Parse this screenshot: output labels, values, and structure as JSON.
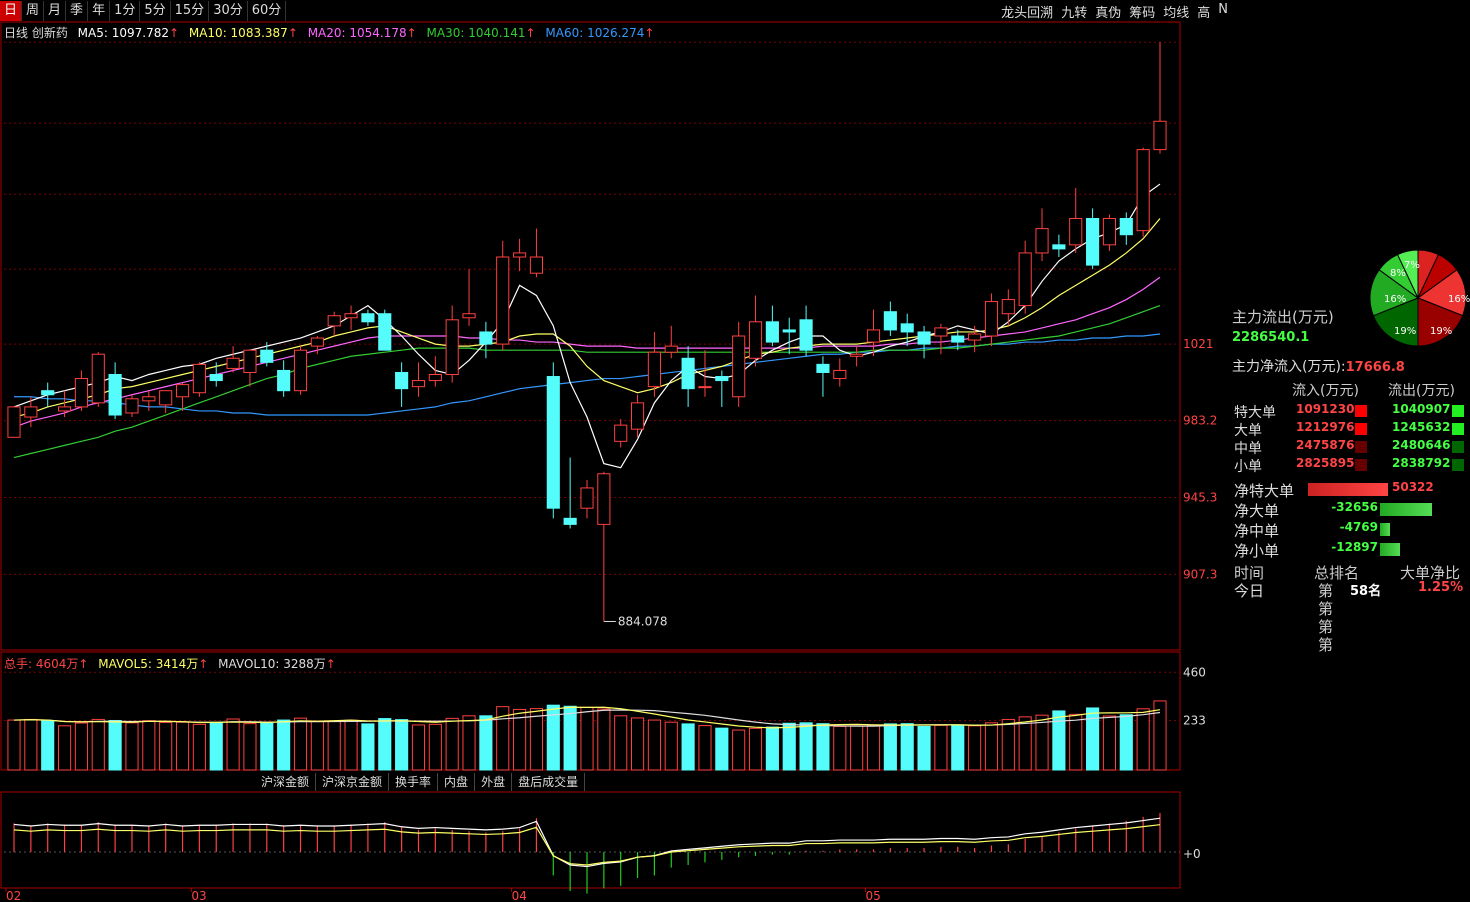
{
  "toolbar": {
    "periods": [
      "日",
      "周",
      "月",
      "季",
      "年",
      "1分",
      "5分",
      "15分",
      "30分",
      "60分"
    ],
    "active_period": "日",
    "right_items": [
      "龙头回溯",
      "九转",
      "真伪",
      "筹码",
      "均线",
      "高",
      "N"
    ]
  },
  "legend": {
    "name": "日线 创新药",
    "ma5": "MA5: 1097.782",
    "ma10": "MA10: 1083.387",
    "ma20": "MA20: 1054.178",
    "ma30": "MA30: 1040.141",
    "ma60": "MA60: 1026.274",
    "arrow": "↑"
  },
  "volume_legend": {
    "total": "总手: 4604万",
    "mavol5": "MAVOL5: 3414万",
    "mavol10": "MAVOL10: 3288万",
    "arrow": "↑"
  },
  "bottom_tabs": [
    "沪深金额",
    "沪深京金额",
    "换手率",
    "内盘",
    "外盘",
    "盘后成交量"
  ],
  "colors": {
    "up": "#ff4040",
    "down": "#54fcfc",
    "ma5": "#ffffff",
    "ma10": "#ffff66",
    "ma20": "#ff66ff",
    "ma30": "#33cc33",
    "ma60": "#3399ff",
    "grid": "#7a0000"
  },
  "chart_data": {
    "type": "candlestick",
    "price_axis_ticks": [
      1021,
      983.2,
      945.3,
      907.3
    ],
    "price_axis_labels": [
      "1021",
      "983.2",
      "945.3",
      "907.3"
    ],
    "price_range": [
      870,
      1180
    ],
    "low_marker": {
      "value": 884.078,
      "label": "884.078"
    },
    "volume_axis_labels": [
      "460",
      "233"
    ],
    "volume_range": [
      0,
      480
    ],
    "indicator_axis_label": "+0",
    "month_labels": [
      {
        "index": 0,
        "label": "02"
      },
      {
        "index": 11,
        "label": "03"
      },
      {
        "index": 30,
        "label": "04"
      },
      {
        "index": 51,
        "label": "05"
      }
    ],
    "candles": [
      {
        "o": 975,
        "h": 990,
        "l": 975,
        "c": 990
      },
      {
        "o": 985,
        "h": 995,
        "l": 980,
        "c": 990
      },
      {
        "o": 998,
        "h": 1002,
        "l": 990,
        "c": 996
      },
      {
        "o": 988,
        "h": 998,
        "l": 985,
        "c": 990
      },
      {
        "o": 990,
        "h": 1008,
        "l": 988,
        "c": 1004
      },
      {
        "o": 992,
        "h": 1017,
        "l": 990,
        "c": 1016
      },
      {
        "o": 1006,
        "h": 1012,
        "l": 984,
        "c": 986
      },
      {
        "o": 987,
        "h": 996,
        "l": 985,
        "c": 994
      },
      {
        "o": 993,
        "h": 998,
        "l": 988,
        "c": 995
      },
      {
        "o": 991,
        "h": 997,
        "l": 987,
        "c": 998
      },
      {
        "o": 995,
        "h": 1002,
        "l": 988,
        "c": 1001
      },
      {
        "o": 997,
        "h": 1012,
        "l": 995,
        "c": 1011
      },
      {
        "o": 1006,
        "h": 1012,
        "l": 1000,
        "c": 1003
      },
      {
        "o": 1009,
        "h": 1020,
        "l": 1007,
        "c": 1014
      },
      {
        "o": 1007,
        "h": 1018,
        "l": 1000,
        "c": 1018
      },
      {
        "o": 1018,
        "h": 1022,
        "l": 1010,
        "c": 1012
      },
      {
        "o": 1008,
        "h": 1013,
        "l": 995,
        "c": 998
      },
      {
        "o": 998,
        "h": 1020,
        "l": 996,
        "c": 1018
      },
      {
        "o": 1020,
        "h": 1025,
        "l": 1016,
        "c": 1024
      },
      {
        "o": 1030,
        "h": 1037,
        "l": 1025,
        "c": 1035
      },
      {
        "o": 1034,
        "h": 1040,
        "l": 1028,
        "c": 1036
      },
      {
        "o": 1036,
        "h": 1038,
        "l": 1030,
        "c": 1032
      },
      {
        "o": 1036,
        "h": 1038,
        "l": 1018,
        "c": 1018
      },
      {
        "o": 1007,
        "h": 1012,
        "l": 990,
        "c": 999
      },
      {
        "o": 1000,
        "h": 1012,
        "l": 995,
        "c": 1003
      },
      {
        "o": 1003,
        "h": 1015,
        "l": 1000,
        "c": 1006
      },
      {
        "o": 1006,
        "h": 1040,
        "l": 1002,
        "c": 1033
      },
      {
        "o": 1034,
        "h": 1058,
        "l": 1030,
        "c": 1036
      },
      {
        "o": 1027,
        "h": 1032,
        "l": 1014,
        "c": 1021
      },
      {
        "o": 1021,
        "h": 1072,
        "l": 1018,
        "c": 1064
      },
      {
        "o": 1064,
        "h": 1073,
        "l": 1057,
        "c": 1066
      },
      {
        "o": 1056,
        "h": 1078,
        "l": 1054,
        "c": 1064
      },
      {
        "o": 1005,
        "h": 1012,
        "l": 935,
        "c": 940
      },
      {
        "o": 935,
        "h": 965,
        "l": 930,
        "c": 932
      },
      {
        "o": 940,
        "h": 954,
        "l": 935,
        "c": 950
      },
      {
        "o": 932,
        "h": 958,
        "l": 884.078,
        "c": 957
      },
      {
        "o": 973,
        "h": 984,
        "l": 970,
        "c": 981
      },
      {
        "o": 979,
        "h": 996,
        "l": 975,
        "c": 992
      },
      {
        "o": 1000,
        "h": 1027,
        "l": 995,
        "c": 1017
      },
      {
        "o": 1017,
        "h": 1030,
        "l": 1014,
        "c": 1020
      },
      {
        "o": 1014,
        "h": 1020,
        "l": 990,
        "c": 999
      },
      {
        "o": 1000,
        "h": 1018,
        "l": 995,
        "c": 1000
      },
      {
        "o": 1005,
        "h": 1008,
        "l": 990,
        "c": 1003
      },
      {
        "o": 995,
        "h": 1032,
        "l": 990,
        "c": 1025
      },
      {
        "o": 1014,
        "h": 1045,
        "l": 1010,
        "c": 1032
      },
      {
        "o": 1032,
        "h": 1040,
        "l": 1020,
        "c": 1022
      },
      {
        "o": 1028,
        "h": 1034,
        "l": 1016,
        "c": 1027
      },
      {
        "o": 1033,
        "h": 1040,
        "l": 1015,
        "c": 1018
      },
      {
        "o": 1011,
        "h": 1015,
        "l": 995,
        "c": 1007
      },
      {
        "o": 1004,
        "h": 1014,
        "l": 1000,
        "c": 1008
      },
      {
        "o": 1015,
        "h": 1020,
        "l": 1010,
        "c": 1016
      },
      {
        "o": 1022,
        "h": 1038,
        "l": 1015,
        "c": 1028
      },
      {
        "o": 1037,
        "h": 1042,
        "l": 1025,
        "c": 1028
      },
      {
        "o": 1031,
        "h": 1036,
        "l": 1020,
        "c": 1027
      },
      {
        "o": 1027,
        "h": 1030,
        "l": 1014,
        "c": 1021
      },
      {
        "o": 1025,
        "h": 1031,
        "l": 1016,
        "c": 1029
      },
      {
        "o": 1025,
        "h": 1028,
        "l": 1018,
        "c": 1022
      },
      {
        "o": 1023,
        "h": 1030,
        "l": 1017,
        "c": 1026
      },
      {
        "o": 1025,
        "h": 1046,
        "l": 1020,
        "c": 1042
      },
      {
        "o": 1036,
        "h": 1048,
        "l": 1030,
        "c": 1043
      },
      {
        "o": 1040,
        "h": 1072,
        "l": 1036,
        "c": 1066
      },
      {
        "o": 1066,
        "h": 1088,
        "l": 1062,
        "c": 1078
      },
      {
        "o": 1070,
        "h": 1075,
        "l": 1064,
        "c": 1068
      },
      {
        "o": 1070,
        "h": 1098,
        "l": 1066,
        "c": 1083
      },
      {
        "o": 1083,
        "h": 1088,
        "l": 1058,
        "c": 1060
      },
      {
        "o": 1070,
        "h": 1085,
        "l": 1067,
        "c": 1083
      },
      {
        "o": 1083,
        "h": 1086,
        "l": 1070,
        "c": 1075
      },
      {
        "o": 1077,
        "h": 1118,
        "l": 1074,
        "c": 1117
      },
      {
        "o": 1117,
        "h": 1170,
        "l": 1115,
        "c": 1131
      }
    ],
    "volumes": [
      235,
      238,
      232,
      208,
      221,
      238,
      233,
      222,
      232,
      224,
      225,
      215,
      224,
      240,
      218,
      220,
      235,
      244,
      230,
      230,
      234,
      217,
      242,
      237,
      212,
      215,
      243,
      255,
      255,
      298,
      285,
      289,
      305,
      300,
      295,
      287,
      255,
      245,
      235,
      225,
      217,
      209,
      197,
      188,
      196,
      202,
      220,
      222,
      218,
      205,
      208,
      210,
      217,
      218,
      205,
      210,
      212,
      208,
      222,
      238,
      250,
      258,
      278,
      262,
      292,
      254,
      260,
      288,
      325
    ],
    "volume_markers": [
      0,
      1,
      1,
      0,
      0,
      0,
      1,
      0,
      0,
      0,
      1,
      0,
      1,
      0,
      0,
      0,
      1,
      0,
      1,
      0,
      0,
      1,
      1,
      0,
      0,
      0,
      1,
      0,
      1,
      0,
      0,
      0,
      1,
      1,
      0,
      0,
      0,
      0,
      0,
      0,
      1,
      0,
      1,
      0,
      0,
      1,
      0,
      1,
      0,
      0,
      1,
      0,
      1,
      1,
      1,
      0,
      0,
      0,
      0,
      0,
      1,
      0,
      1,
      0,
      1,
      0,
      1,
      1,
      0
    ],
    "macd": [
      22,
      20,
      22,
      21,
      21,
      23,
      21,
      21,
      20,
      22,
      20,
      21,
      21,
      22,
      22,
      22,
      20,
      21,
      20,
      20,
      21,
      22,
      23,
      19,
      17,
      18,
      17,
      16,
      15,
      16,
      18,
      26,
      -18,
      -30,
      -32,
      -28,
      -26,
      -20,
      -18,
      -12,
      -10,
      -8,
      -6,
      -4,
      -3,
      -2,
      -2,
      1,
      1,
      2,
      2,
      2,
      3,
      3,
      3,
      4,
      4,
      3,
      5,
      6,
      10,
      12,
      15,
      18,
      20,
      22,
      24,
      27,
      30
    ],
    "ma5": [
      990,
      993,
      996,
      998,
      1000,
      1002,
      1005,
      1003,
      1006,
      1008,
      1010,
      1011,
      1014,
      1016,
      1018,
      1020,
      1022,
      1024,
      1027,
      1030,
      1035,
      1040,
      1033,
      1025,
      1016,
      1008,
      1006,
      1013,
      1022,
      1032,
      1050,
      1045,
      1030,
      1002,
      985,
      962,
      960,
      974,
      992,
      1003,
      1010,
      1005,
      1004,
      1006,
      1013,
      1018,
      1022,
      1025,
      1025,
      1018,
      1015,
      1017,
      1020,
      1022,
      1025,
      1027,
      1030,
      1028,
      1026,
      1032,
      1040,
      1052,
      1062,
      1068,
      1073,
      1076,
      1080,
      1094,
      1100
    ],
    "ma10": [
      985,
      987,
      990,
      992,
      994,
      996,
      999,
      1000,
      1002,
      1004,
      1006,
      1008,
      1010,
      1012,
      1014,
      1016,
      1018,
      1020,
      1022,
      1025,
      1027,
      1029,
      1030,
      1027,
      1024,
      1021,
      1020,
      1020,
      1021,
      1022,
      1025,
      1026,
      1026,
      1020,
      1010,
      1003,
      1000,
      997,
      999,
      1002,
      1006,
      1008,
      1010,
      1013,
      1016,
      1017,
      1019,
      1020,
      1021,
      1021,
      1021,
      1022,
      1023,
      1024,
      1025,
      1026,
      1027,
      1027,
      1028,
      1030,
      1034,
      1039,
      1045,
      1050,
      1055,
      1060,
      1066,
      1073,
      1083
    ],
    "ma20": [
      980,
      983,
      985,
      987,
      990,
      992,
      994,
      996,
      998,
      1000,
      1002,
      1004,
      1006,
      1008,
      1010,
      1012,
      1014,
      1016,
      1018,
      1020,
      1022,
      1024,
      1025,
      1025,
      1025,
      1025,
      1025,
      1024,
      1024,
      1023,
      1023,
      1022,
      1022,
      1021,
      1020,
      1020,
      1020,
      1019,
      1019,
      1019,
      1019,
      1019,
      1019,
      1019,
      1019,
      1019,
      1019,
      1019,
      1020,
      1020,
      1020,
      1020,
      1021,
      1021,
      1022,
      1022,
      1023,
      1024,
      1025,
      1026,
      1027,
      1029,
      1031,
      1033,
      1036,
      1039,
      1043,
      1048,
      1054
    ],
    "ma30": [
      965,
      967,
      969,
      971,
      973,
      975,
      978,
      980,
      983,
      986,
      989,
      992,
      995,
      998,
      1001,
      1004,
      1006,
      1009,
      1011,
      1013,
      1015,
      1016,
      1017,
      1018,
      1019,
      1019,
      1019,
      1019,
      1018,
      1018,
      1018,
      1018,
      1018,
      1018,
      1017,
      1017,
      1017,
      1017,
      1017,
      1017,
      1017,
      1017,
      1017,
      1017,
      1017,
      1017,
      1017,
      1017,
      1017,
      1017,
      1017,
      1018,
      1018,
      1018,
      1018,
      1019,
      1019,
      1020,
      1021,
      1022,
      1023,
      1024,
      1025,
      1027,
      1029,
      1031,
      1034,
      1037,
      1040
    ],
    "ma60": [
      995,
      995,
      994,
      994,
      993,
      993,
      992,
      991,
      990,
      990,
      989,
      988,
      988,
      987,
      987,
      986,
      986,
      986,
      986,
      986,
      986,
      986,
      987,
      988,
      989,
      990,
      992,
      993,
      995,
      997,
      999,
      1000,
      1001,
      1002,
      1003,
      1004,
      1004,
      1005,
      1006,
      1007,
      1008,
      1009,
      1010,
      1011,
      1012,
      1013,
      1014,
      1015,
      1016,
      1016,
      1017,
      1017,
      1018,
      1018,
      1019,
      1019,
      1020,
      1020,
      1021,
      1021,
      1022,
      1022,
      1023,
      1023,
      1024,
      1024,
      1025,
      1025,
      1026
    ]
  },
  "fund_panel": {
    "pie_labels": [
      "7%",
      "8%",
      "16%",
      "16%",
      "19%",
      "19%"
    ],
    "outflow_title": "主力流出(万元)",
    "outflow_value": "2286540.1",
    "net_inflow_label": "主力净流入(万元):",
    "net_inflow_value": "17666.8",
    "col_in": "流入(万元)",
    "col_out": "流出(万元)",
    "rows": [
      {
        "label": "特大单",
        "in": "1091230",
        "out": "1040907"
      },
      {
        "label": "大单",
        "in": "1212976",
        "out": "1245632"
      },
      {
        "label": "中单",
        "in": "2475876",
        "out": "2480646"
      },
      {
        "label": "小单",
        "in": "2825895",
        "out": "2838792"
      }
    ],
    "net_rows": [
      {
        "label": "净特大单",
        "value": "50322",
        "ratio": 0.8
      },
      {
        "label": "净大单",
        "value": "-32656",
        "ratio": 0.52
      },
      {
        "label": "净中单",
        "value": "-4769",
        "ratio": 0.1
      },
      {
        "label": "净小单",
        "value": "-12897",
        "ratio": 0.2
      }
    ],
    "rank_header": [
      "时间",
      "总排名",
      "大单净比"
    ],
    "rank_rows": [
      {
        "time": "今日",
        "prefix": "第",
        "rank": "58名",
        "ratio": "1.25%"
      }
    ],
    "rank_extra_prefix": [
      "第",
      "第",
      "第"
    ]
  }
}
